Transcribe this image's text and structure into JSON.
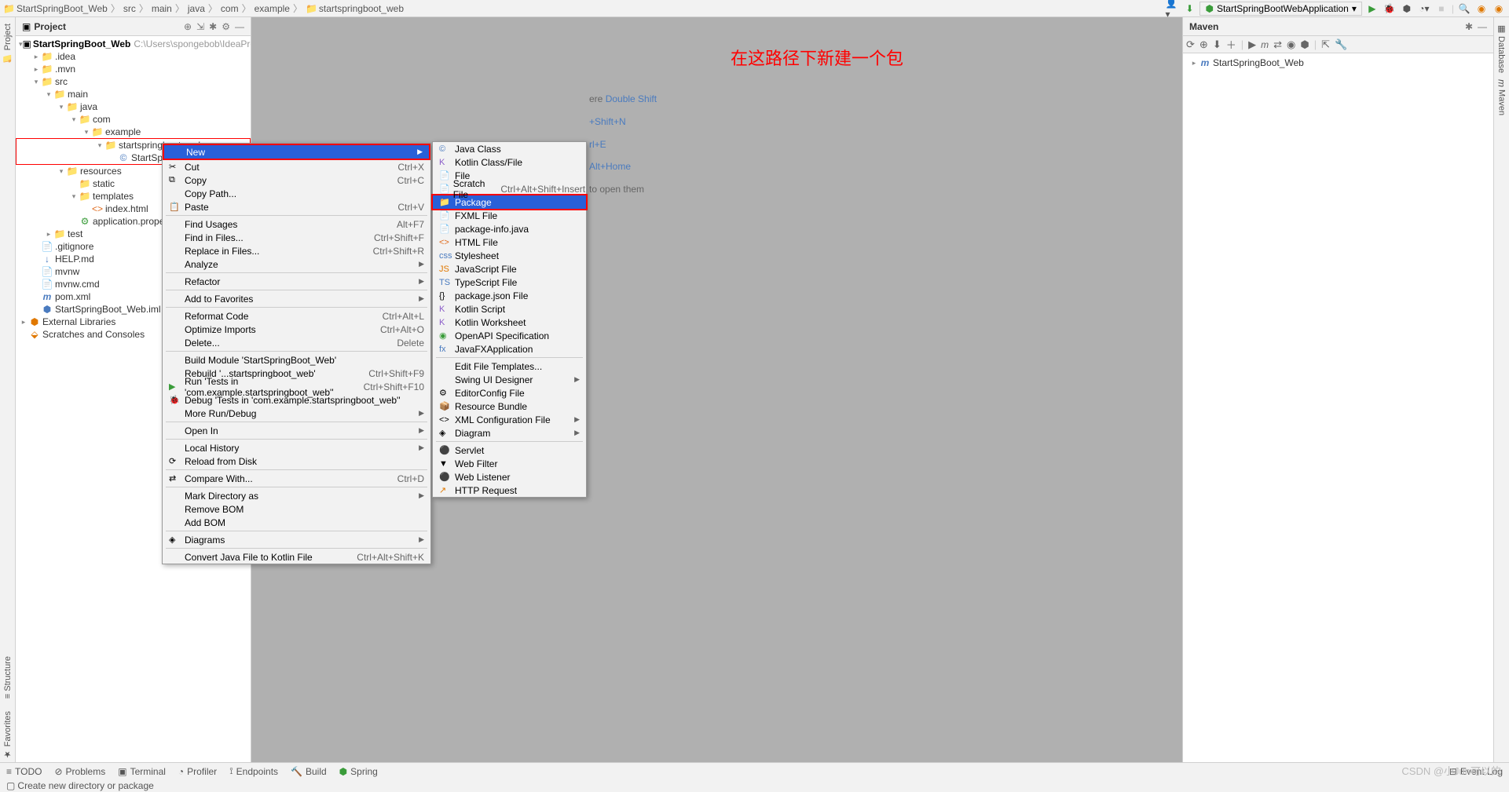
{
  "breadcrumb": [
    "StartSpringBoot_Web",
    "src",
    "main",
    "java",
    "com",
    "example",
    "startspringboot_web"
  ],
  "topbar": {
    "run_config": "StartSpringBootWebApplication"
  },
  "project": {
    "title": "Project",
    "root": "StartSpringBoot_Web",
    "root_path": "C:\\Users\\spongebob\\IdeaProjects\\",
    "tree": {
      "idea": ".idea",
      "mvn": ".mvn",
      "src": "src",
      "main": "main",
      "java": "java",
      "com": "com",
      "example": "example",
      "pkg": "startspringboot_web",
      "app": "StartSpringB",
      "resources": "resources",
      "static": "static",
      "templates": "templates",
      "index": "index.html",
      "appprops": "application.propertie",
      "test": "test",
      "gitignore": ".gitignore",
      "help": "HELP.md",
      "mvnw": "mvnw",
      "mvnwcmd": "mvnw.cmd",
      "pom": "pom.xml",
      "iml": "StartSpringBoot_Web.iml",
      "extlib": "External Libraries",
      "scratches": "Scratches and Consoles"
    }
  },
  "annotation": "在这路径下新建一个包",
  "hints": {
    "h1_pre": "ere ",
    "h1_key": "Double Shift",
    "h2_key": "+Shift+N",
    "h3_key": "rl+E",
    "h4_key": "Alt+Home",
    "h5": "to open them"
  },
  "menu1": [
    {
      "label": "New",
      "sub": true,
      "hl": true,
      "red": true
    },
    {
      "icon": "✂",
      "label": "Cut",
      "shortcut": "Ctrl+X",
      "u": "t"
    },
    {
      "icon": "⧉",
      "label": "Copy",
      "shortcut": "Ctrl+C",
      "u": "C"
    },
    {
      "label": "Copy Path..."
    },
    {
      "icon": "📋",
      "label": "Paste",
      "shortcut": "Ctrl+V",
      "u": "P"
    },
    {
      "sep": true
    },
    {
      "label": "Find Usages",
      "shortcut": "Alt+F7",
      "u": "U"
    },
    {
      "label": "Find in Files...",
      "shortcut": "Ctrl+Shift+F"
    },
    {
      "label": "Replace in Files...",
      "shortcut": "Ctrl+Shift+R"
    },
    {
      "label": "Analyze",
      "sub": true,
      "u": "z"
    },
    {
      "sep": true
    },
    {
      "label": "Refactor",
      "sub": true,
      "u": "R"
    },
    {
      "sep": true
    },
    {
      "label": "Add to Favorites",
      "sub": true
    },
    {
      "sep": true
    },
    {
      "label": "Reformat Code",
      "shortcut": "Ctrl+Alt+L",
      "u": "R"
    },
    {
      "label": "Optimize Imports",
      "shortcut": "Ctrl+Alt+O",
      "u": "z"
    },
    {
      "label": "Delete...",
      "shortcut": "Delete",
      "u": "D"
    },
    {
      "sep": true
    },
    {
      "label": "Build Module 'StartSpringBoot_Web'"
    },
    {
      "label": "Rebuild '...startspringboot_web'",
      "shortcut": "Ctrl+Shift+F9"
    },
    {
      "icon": "▶",
      "iconcls": "ic-green",
      "label": "Run 'Tests in 'com.example.startspringboot_web''",
      "shortcut": "Ctrl+Shift+F10"
    },
    {
      "icon": "🐞",
      "iconcls": "ic-green",
      "label": "Debug 'Tests in 'com.example.startspringboot_web''"
    },
    {
      "label": "More Run/Debug",
      "sub": true
    },
    {
      "sep": true
    },
    {
      "label": "Open In",
      "sub": true
    },
    {
      "sep": true
    },
    {
      "label": "Local History",
      "sub": true,
      "u": "H"
    },
    {
      "icon": "⟳",
      "label": "Reload from Disk"
    },
    {
      "sep": true
    },
    {
      "icon": "⇄",
      "label": "Compare With...",
      "shortcut": "Ctrl+D"
    },
    {
      "sep": true
    },
    {
      "label": "Mark Directory as",
      "sub": true
    },
    {
      "label": "Remove BOM"
    },
    {
      "label": "Add BOM"
    },
    {
      "sep": true
    },
    {
      "icon": "◈",
      "label": "Diagrams",
      "sub": true,
      "u": "D"
    },
    {
      "sep": true
    },
    {
      "label": "Convert Java File to Kotlin File",
      "shortcut": "Ctrl+Alt+Shift+K"
    }
  ],
  "menu2": [
    {
      "icon": "©",
      "iconcls": "ic-java",
      "label": "Java Class"
    },
    {
      "icon": "K",
      "iconcls": "ic-purple",
      "label": "Kotlin Class/File"
    },
    {
      "icon": "📄",
      "label": "File"
    },
    {
      "icon": "📄",
      "label": "Scratch File",
      "shortcut": "Ctrl+Alt+Shift+Insert"
    },
    {
      "icon": "📁",
      "iconcls": "ic-folder",
      "label": "Package",
      "hl": true,
      "red": true
    },
    {
      "icon": "📄",
      "iconcls": "ic-java",
      "label": "FXML File"
    },
    {
      "icon": "📄",
      "label": "package-info.java"
    },
    {
      "icon": "<>",
      "iconcls": "ic-html",
      "label": "HTML File"
    },
    {
      "icon": "css",
      "iconcls": "ic-java",
      "label": "Stylesheet"
    },
    {
      "icon": "JS",
      "iconcls": "ic-orange",
      "label": "JavaScript File"
    },
    {
      "icon": "TS",
      "iconcls": "ic-java",
      "label": "TypeScript File"
    },
    {
      "icon": "{}",
      "label": "package.json File"
    },
    {
      "icon": "K",
      "iconcls": "ic-purple",
      "label": "Kotlin Script"
    },
    {
      "icon": "K",
      "iconcls": "ic-purple",
      "label": "Kotlin Worksheet"
    },
    {
      "icon": "◉",
      "iconcls": "ic-green",
      "label": "OpenAPI Specification"
    },
    {
      "icon": "fx",
      "iconcls": "ic-java",
      "label": "JavaFXApplication"
    },
    {
      "sep": true
    },
    {
      "label": "Edit File Templates..."
    },
    {
      "label": "Swing UI Designer",
      "sub": true
    },
    {
      "icon": "⚙",
      "label": "EditorConfig File"
    },
    {
      "icon": "📦",
      "label": "Resource Bundle"
    },
    {
      "icon": "<>",
      "label": "XML Configuration File",
      "sub": true
    },
    {
      "icon": "◈",
      "label": "Diagram",
      "sub": true
    },
    {
      "sep": true
    },
    {
      "icon": "⚫",
      "label": "Servlet"
    },
    {
      "icon": "▼",
      "label": "Web Filter"
    },
    {
      "icon": "⚫",
      "label": "Web Listener"
    },
    {
      "icon": "↗",
      "iconcls": "ic-orange",
      "label": "HTTP Request"
    }
  ],
  "maven": {
    "title": "Maven",
    "root": "StartSpringBoot_Web"
  },
  "bottom": {
    "todo": "TODO",
    "problems": "Problems",
    "terminal": "Terminal",
    "profiler": "Profiler",
    "endpoints": "Endpoints",
    "build": "Build",
    "spring": "Spring",
    "eventlog": "Event Log"
  },
  "status": "Create new directory or package",
  "watermark": "CSDN @小Jun可以的"
}
